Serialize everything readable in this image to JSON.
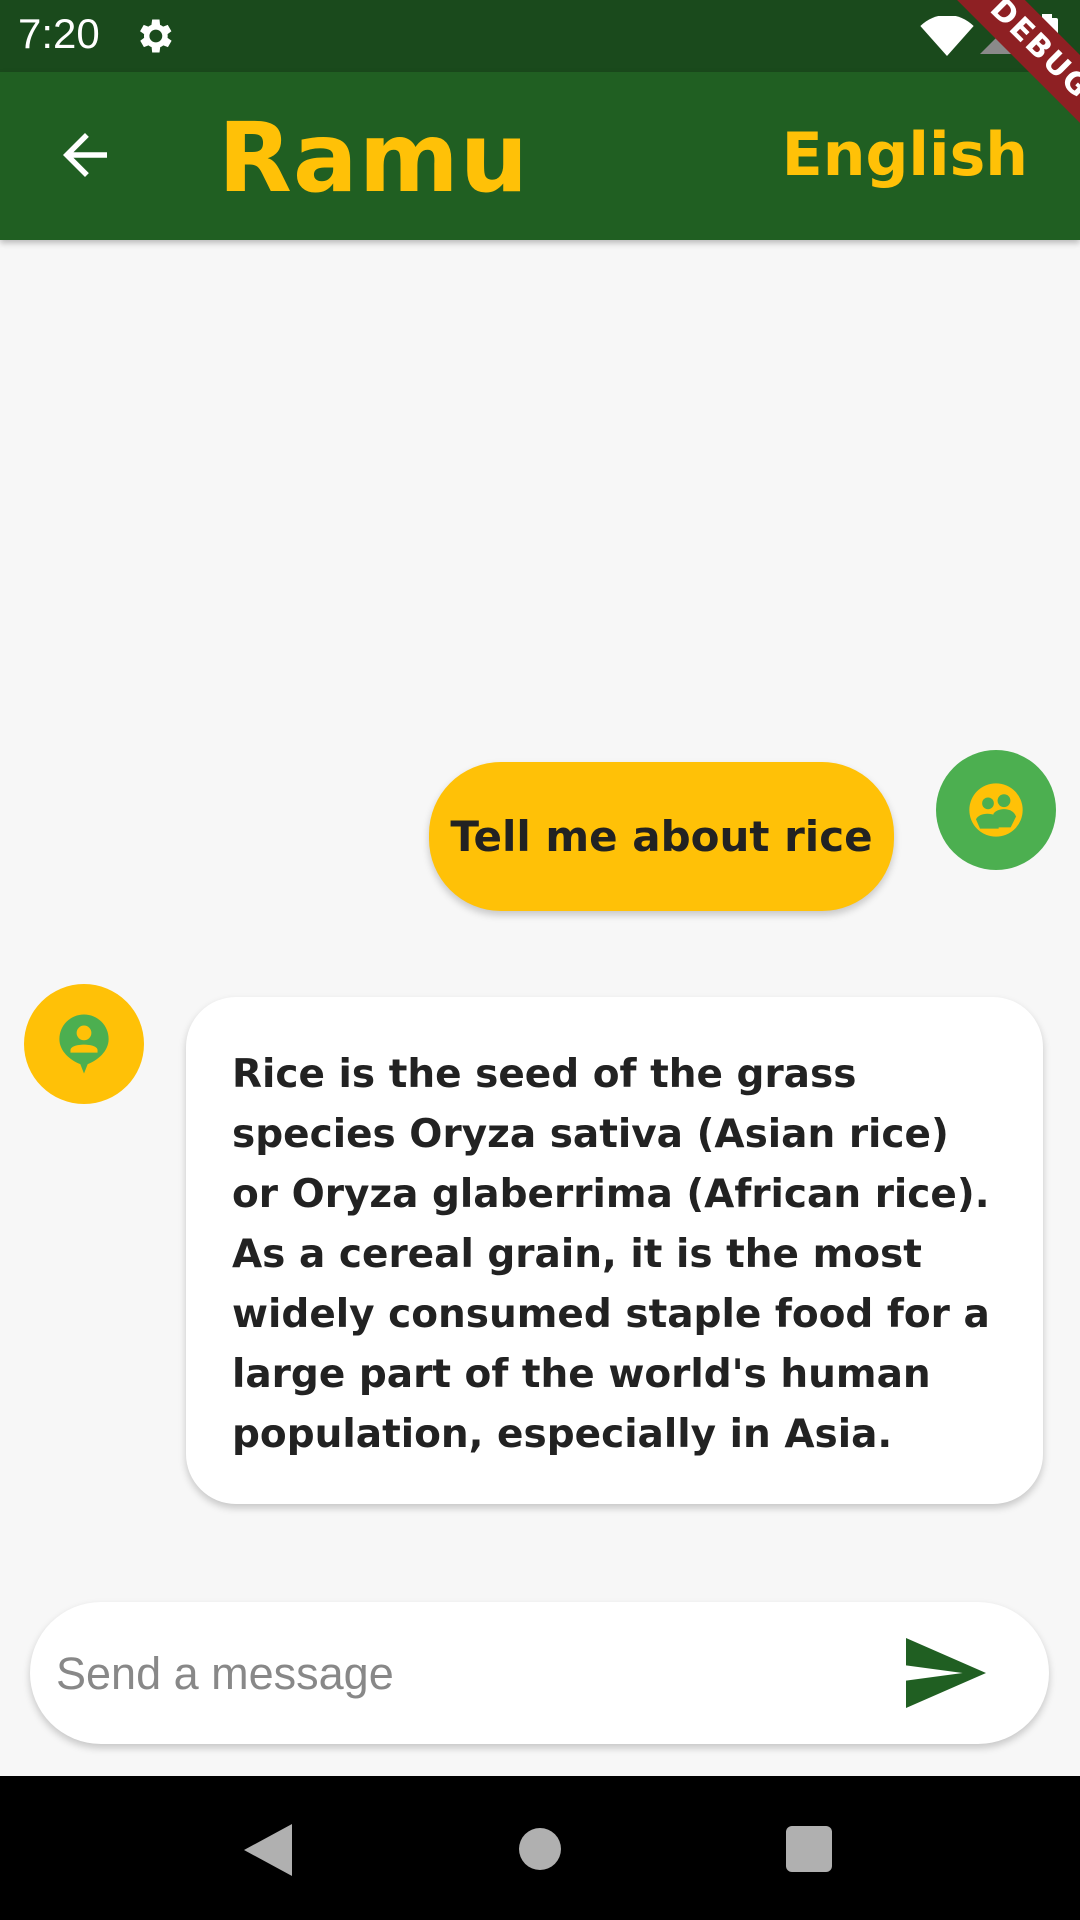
{
  "status_bar": {
    "time": "7:20",
    "icons": [
      "gear-icon",
      "wifi-icon",
      "signal-icon",
      "battery-icon"
    ]
  },
  "app_bar": {
    "back_icon": "arrow-left-icon",
    "title": "Ramu",
    "language": "English"
  },
  "debug_banner": "DEBUG",
  "chat": {
    "messages": [
      {
        "sender": "user",
        "avatar_icon": "user-avatar-icon",
        "text": "Tell me about rice"
      },
      {
        "sender": "bot",
        "avatar_icon": "bot-avatar-icon",
        "text": "Rice is the seed of the grass species Oryza sativa (Asian rice) or Oryza glaberrima (African rice). As a cereal grain, it is the most widely consumed staple food for a large part of the world's human population, especially in Asia."
      }
    ]
  },
  "composer": {
    "placeholder": "Send a message",
    "value": "",
    "send_icon": "send-icon"
  },
  "nav_bar": {
    "icons": [
      "back-triangle-icon",
      "home-circle-icon",
      "recents-square-icon"
    ]
  },
  "colors": {
    "status_bar_bg": "#1a4a1c",
    "app_bar_bg": "#205f22",
    "accent_yellow": "#ffc107",
    "user_avatar_bg": "#4caf50",
    "send_icon": "#205f22",
    "debug_banner": "#8e2023"
  }
}
